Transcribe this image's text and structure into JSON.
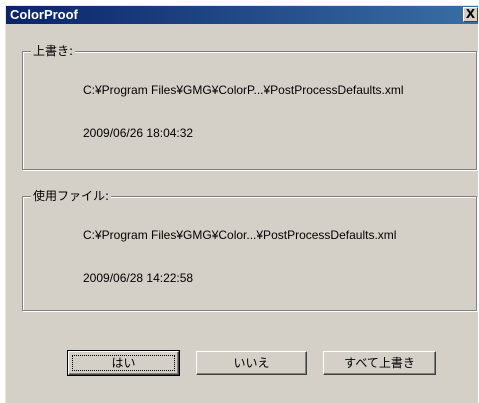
{
  "window": {
    "title": "ColorProof",
    "close_glyph": "X"
  },
  "overwrite_group": {
    "label": "上書き:",
    "path": "C:¥Program Files¥GMG¥ColorP...¥PostProcessDefaults.xml",
    "date": "2009/06/26 18:04:32"
  },
  "used_file_group": {
    "label": "使用ファイル:",
    "path": "C:¥Program Files¥GMG¥Color...¥PostProcessDefaults.xml",
    "date": "2009/06/28 14:22:58"
  },
  "buttons": {
    "yes": "はい",
    "no": "いいえ",
    "overwrite_all": "すべて上書き"
  }
}
